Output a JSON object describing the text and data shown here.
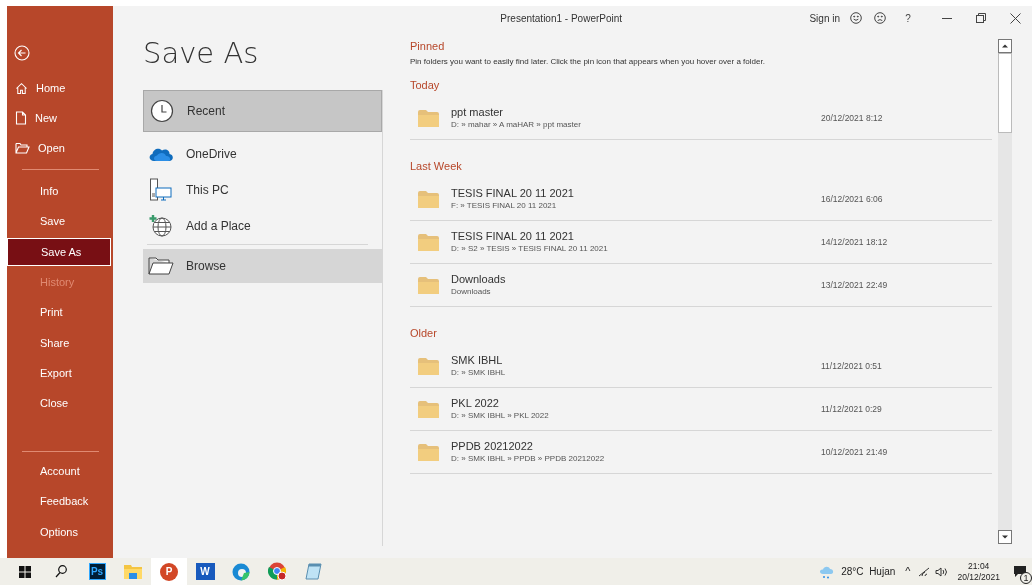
{
  "window": {
    "title": "Presentation1  -  PowerPoint",
    "sign_in": "Sign in",
    "help": "?"
  },
  "sidebar": {
    "top_items": [
      {
        "label": "Home",
        "kind": "home",
        "selected": false,
        "disabled": false
      },
      {
        "label": "New",
        "kind": "new",
        "selected": false,
        "disabled": false
      },
      {
        "label": "Open",
        "kind": "open",
        "selected": false,
        "disabled": false
      }
    ],
    "middle_items": [
      {
        "label": "Info",
        "selected": false,
        "disabled": false
      },
      {
        "label": "Save",
        "selected": false,
        "disabled": false
      },
      {
        "label": "Save As",
        "selected": true,
        "disabled": false
      },
      {
        "label": "History",
        "selected": false,
        "disabled": true
      },
      {
        "label": "Print",
        "selected": false,
        "disabled": false
      },
      {
        "label": "Share",
        "selected": false,
        "disabled": false
      },
      {
        "label": "Export",
        "selected": false,
        "disabled": false
      },
      {
        "label": "Close",
        "selected": false,
        "disabled": false
      }
    ],
    "bottom_items": [
      {
        "label": "Account",
        "selected": false,
        "disabled": false
      },
      {
        "label": "Feedback",
        "selected": false,
        "disabled": false
      },
      {
        "label": "Options",
        "selected": false,
        "disabled": false
      }
    ]
  },
  "page_title": "Save As",
  "places": [
    {
      "label": "Recent",
      "kind": "recent",
      "selected": true,
      "hovered": false
    },
    {
      "label": "OneDrive",
      "kind": "onedrive",
      "selected": false,
      "hovered": false
    },
    {
      "label": "This PC",
      "kind": "pc",
      "selected": false,
      "hovered": false
    },
    {
      "label": "Add a Place",
      "kind": "add",
      "selected": false,
      "hovered": false
    },
    {
      "label": "Browse",
      "kind": "browse",
      "selected": false,
      "hovered": true
    }
  ],
  "pinned": {
    "heading": "Pinned",
    "hint": "Pin folders you want to easily find later. Click the pin icon that appears when you hover over a folder."
  },
  "groups": [
    {
      "heading": "Today",
      "folders": [
        {
          "name": "ppt master",
          "path": "D: » mahar » A maHAR » ppt master",
          "date": "20/12/2021 8:12"
        }
      ]
    },
    {
      "heading": "Last Week",
      "folders": [
        {
          "name": "TESIS FINAL 20 11 2021",
          "path": "F: » TESIS FINAL 20 11 2021",
          "date": "16/12/2021 6:06"
        },
        {
          "name": "TESIS FINAL 20 11 2021",
          "path": "D: » S2 » TESIS » TESIS FINAL 20 11 2021",
          "date": "14/12/2021 18:12"
        },
        {
          "name": "Downloads",
          "path": "Downloads",
          "date": "13/12/2021 22:49"
        }
      ]
    },
    {
      "heading": "Older",
      "folders": [
        {
          "name": "SMK IBHL",
          "path": "D: » SMK IBHL",
          "date": "11/12/2021 0:51"
        },
        {
          "name": "PKL 2022",
          "path": "D: » SMK IBHL » PKL 2022",
          "date": "11/12/2021 0:29"
        },
        {
          "name": "PPDB 20212022",
          "path": "D: » SMK IBHL » PPDB » PPDB 20212022",
          "date": "10/12/2021 21:49"
        }
      ]
    }
  ],
  "taskbar": {
    "apps": [
      {
        "kind": "photoshop",
        "label": "Ps",
        "active": false
      },
      {
        "kind": "explorer",
        "active": false
      },
      {
        "kind": "powerpoint",
        "label": "P",
        "active": true
      },
      {
        "kind": "word",
        "label": "W",
        "active": false
      },
      {
        "kind": "edge",
        "active": false
      },
      {
        "kind": "chrome",
        "active": false
      },
      {
        "kind": "notepad",
        "active": false
      }
    ],
    "weather": "28°C  Hujan",
    "chevron": "^",
    "time": "21:04",
    "date": "20/12/2021",
    "notifications": "1"
  }
}
